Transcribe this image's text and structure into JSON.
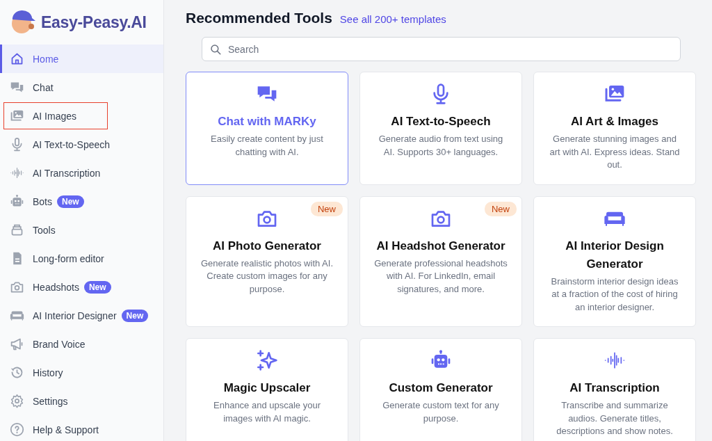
{
  "brand": {
    "name": "Easy-Peasy.AI"
  },
  "sidebar": {
    "items": [
      {
        "label": "Home",
        "selected": true,
        "highlighted": false
      },
      {
        "label": "Chat",
        "selected": false,
        "highlighted": false
      },
      {
        "label": "AI Images",
        "selected": false,
        "highlighted": true
      },
      {
        "label": "AI Text-to-Speech",
        "selected": false,
        "highlighted": false
      },
      {
        "label": "AI Transcription",
        "selected": false,
        "highlighted": false
      },
      {
        "label": "Bots",
        "badge": "New",
        "selected": false,
        "highlighted": false
      },
      {
        "label": "Tools",
        "selected": false,
        "highlighted": false
      },
      {
        "label": "Long-form editor",
        "selected": false,
        "highlighted": false
      },
      {
        "label": "Headshots",
        "badge": "New",
        "selected": false,
        "highlighted": false
      },
      {
        "label": "AI Interior Designer",
        "badge": "New",
        "selected": false,
        "highlighted": false
      },
      {
        "label": "Brand Voice",
        "selected": false,
        "highlighted": false
      },
      {
        "label": "History",
        "selected": false,
        "highlighted": false
      },
      {
        "label": "Settings",
        "selected": false,
        "highlighted": false
      },
      {
        "label": "Help & Support",
        "selected": false,
        "highlighted": false
      }
    ]
  },
  "main": {
    "title": "Recommended Tools",
    "see_all_link": "See all 200+ templates",
    "search": {
      "placeholder": "Search"
    },
    "cards": [
      {
        "title": "Chat with MARKy",
        "description": "Easily create content by just chatting with AI.",
        "selected": true
      },
      {
        "title": "AI Text-to-Speech",
        "description": "Generate audio from text using AI. Supports 30+ languages.",
        "selected": false
      },
      {
        "title": "AI Art & Images",
        "description": "Generate stunning images and art with AI. Express ideas. Stand out.",
        "selected": false
      },
      {
        "title": "AI Photo Generator",
        "description": "Generate realistic photos with AI. Create custom images for any purpose.",
        "badge": "New",
        "selected": false
      },
      {
        "title": "AI Headshot Generator",
        "description": "Generate professional headshots with AI. For LinkedIn, email signatures, and more.",
        "badge": "New",
        "selected": false
      },
      {
        "title": "AI Interior Design Generator",
        "description": "Brainstorm interior design ideas at a fraction of the cost of hiring an interior designer.",
        "selected": false
      },
      {
        "title": "Magic Upscaler",
        "description": "Enhance and upscale your images with AI magic.",
        "selected": false
      },
      {
        "title": "Custom Generator",
        "description": "Generate custom text for any purpose.",
        "selected": false
      },
      {
        "title": "AI Transcription",
        "description": "Transcribe and summarize audios. Generate titles, descriptions and show notes.",
        "selected": false
      }
    ]
  }
}
